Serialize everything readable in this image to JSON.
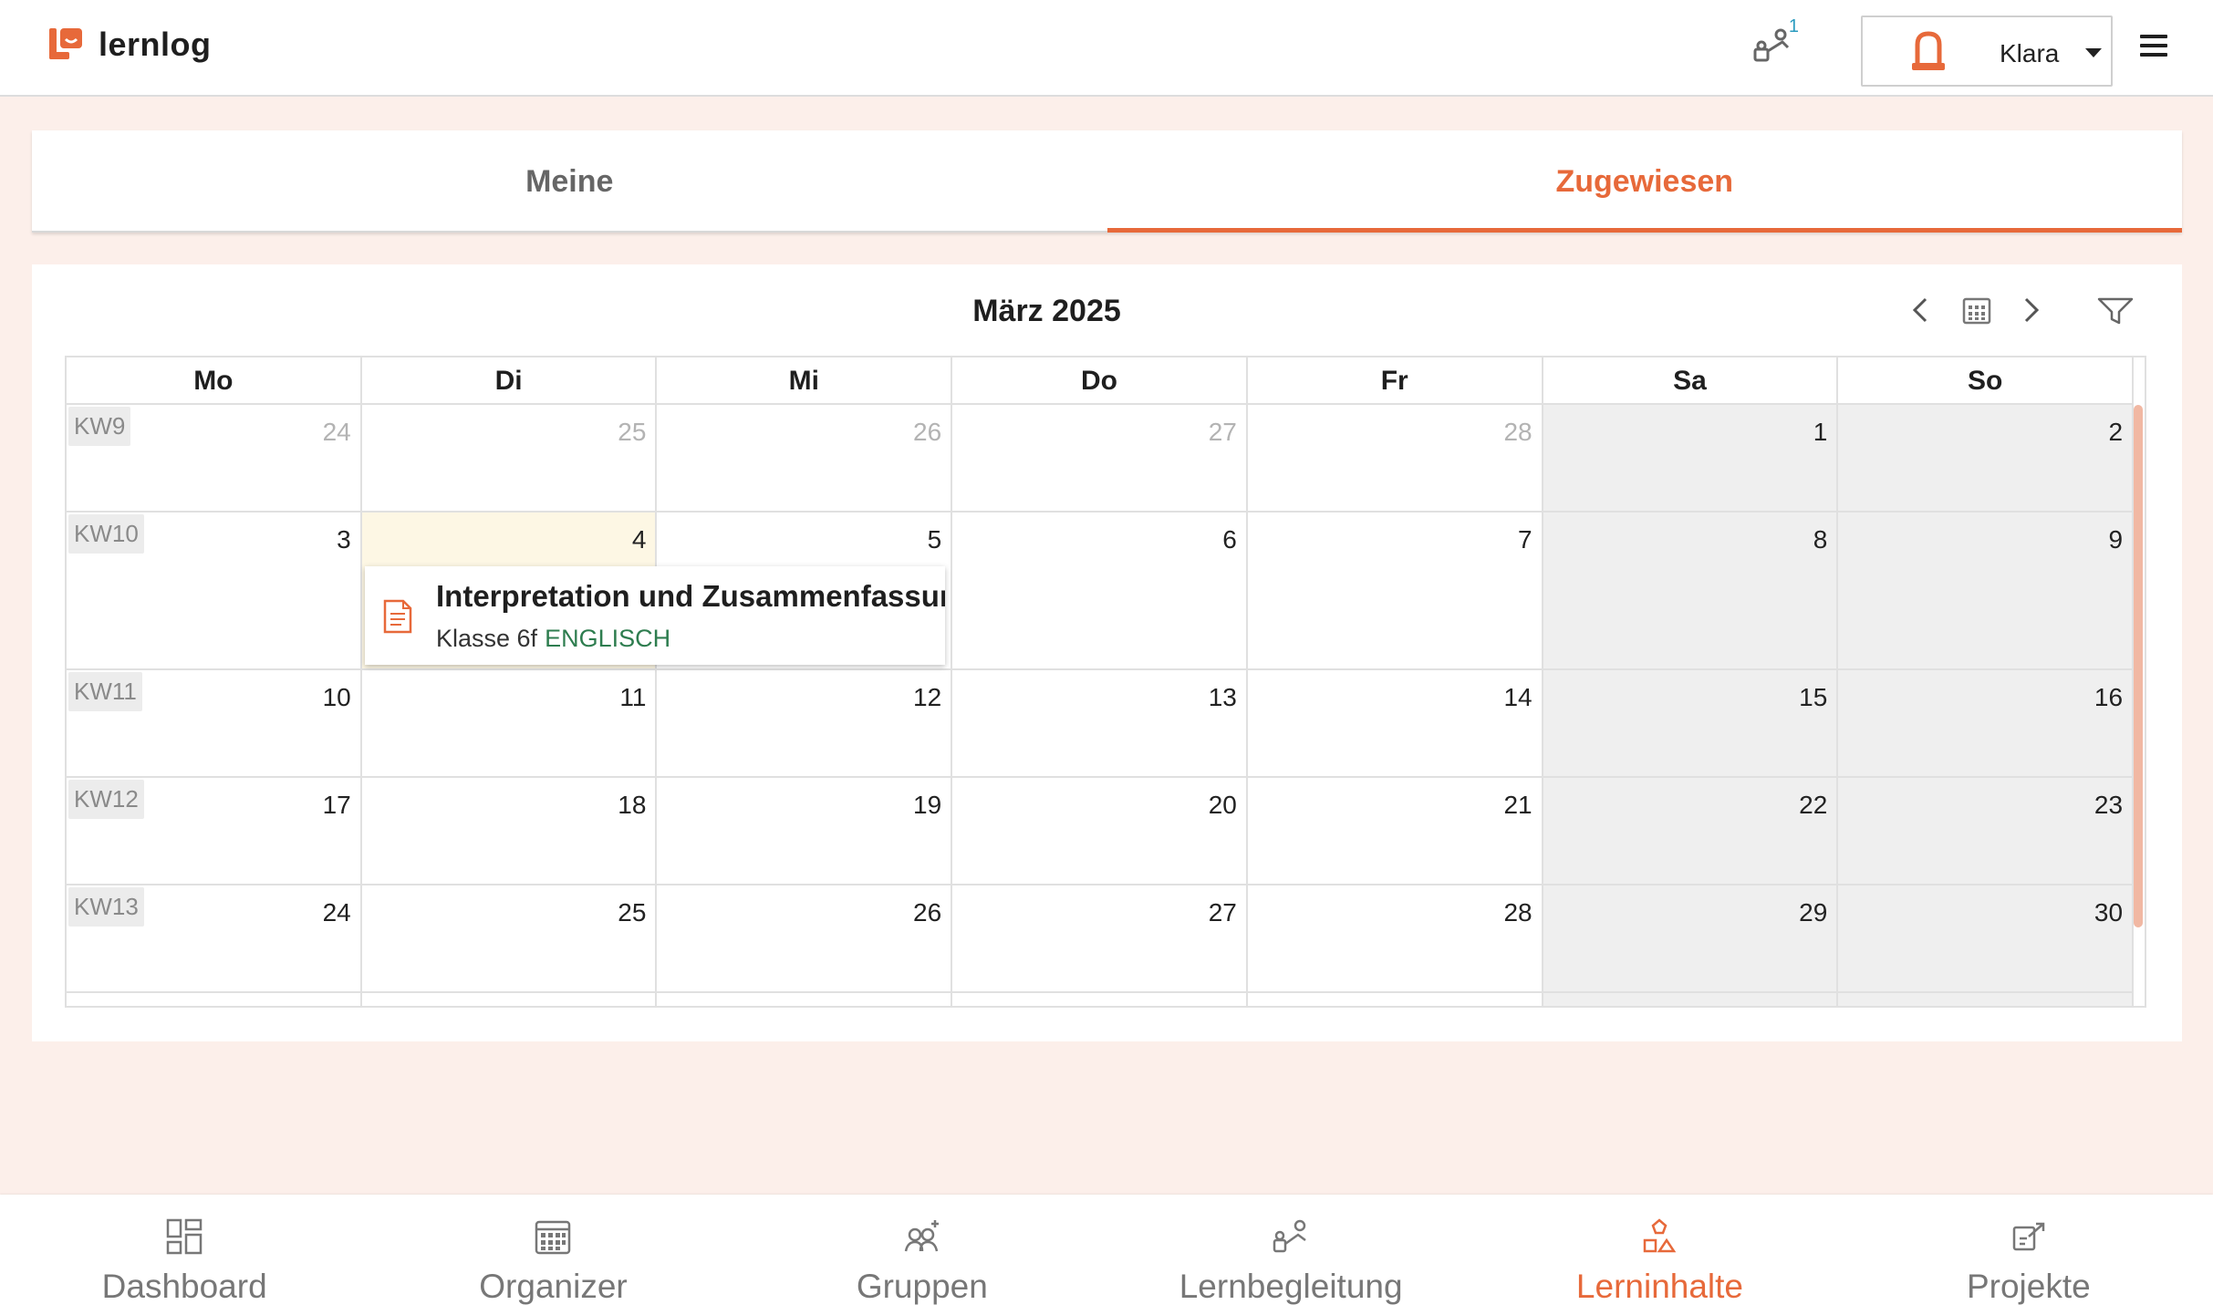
{
  "app": {
    "name": "lernlog"
  },
  "header": {
    "notification_count": "1",
    "user_name": "Klara"
  },
  "tabs": [
    {
      "label": "Meine",
      "active": false
    },
    {
      "label": "Zugewiesen",
      "active": true
    }
  ],
  "calendar": {
    "title": "März 2025",
    "weekdays": [
      "Mo",
      "Di",
      "Mi",
      "Do",
      "Fr",
      "Sa",
      "So"
    ],
    "weeks": [
      {
        "kw": "KW9",
        "days": [
          "24",
          "25",
          "26",
          "27",
          "28",
          "1",
          "2"
        ],
        "muted": [
          true,
          true,
          true,
          true,
          true,
          false,
          false
        ]
      },
      {
        "kw": "KW10",
        "days": [
          "3",
          "4",
          "5",
          "6",
          "7",
          "8",
          "9"
        ],
        "muted": [
          false,
          false,
          false,
          false,
          false,
          false,
          false
        ]
      },
      {
        "kw": "KW11",
        "days": [
          "10",
          "11",
          "12",
          "13",
          "14",
          "15",
          "16"
        ],
        "muted": [
          false,
          false,
          false,
          false,
          false,
          false,
          false
        ]
      },
      {
        "kw": "KW12",
        "days": [
          "17",
          "18",
          "19",
          "20",
          "21",
          "22",
          "23"
        ],
        "muted": [
          false,
          false,
          false,
          false,
          false,
          false,
          false
        ]
      },
      {
        "kw": "KW13",
        "days": [
          "24",
          "25",
          "26",
          "27",
          "28",
          "29",
          "30"
        ],
        "muted": [
          false,
          false,
          false,
          false,
          false,
          false,
          false
        ]
      }
    ],
    "today": "4",
    "event": {
      "title": "Interpretation und Zusammenfassung",
      "class": "Klasse 6f",
      "subject": "ENGLISCH"
    }
  },
  "bottom_nav": [
    {
      "label": "Dashboard",
      "icon": "dashboard-icon",
      "active": false
    },
    {
      "label": "Organizer",
      "icon": "calendar-icon",
      "active": false
    },
    {
      "label": "Gruppen",
      "icon": "group-icon",
      "active": false
    },
    {
      "label": "Lernbegleitung",
      "icon": "mentoring-icon",
      "active": false
    },
    {
      "label": "Lerninhalte",
      "icon": "shapes-icon",
      "active": true
    },
    {
      "label": "Projekte",
      "icon": "projects-icon",
      "active": false
    }
  ],
  "colors": {
    "accent": "#e7693a",
    "subject": "#2e7d4f",
    "background": "#fcefea"
  }
}
